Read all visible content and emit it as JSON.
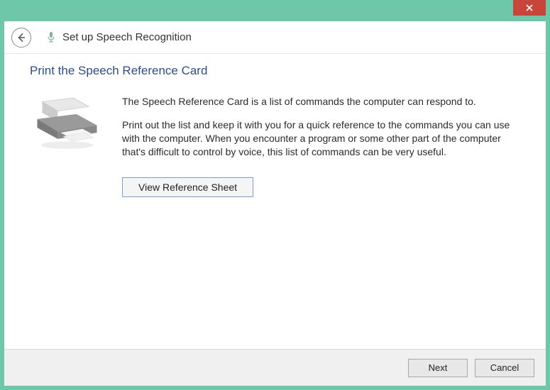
{
  "window": {
    "title": "Set up Speech Recognition"
  },
  "page": {
    "heading": "Print the Speech Reference Card",
    "intro": "The Speech Reference Card is a list of commands the computer can respond to.",
    "details": "Print out the list and keep it with you for a quick reference to the commands you can use with the computer. When you encounter a program or some other part of the computer that's difficult to control by voice, this list of commands can be very useful.",
    "view_button": "View Reference Sheet"
  },
  "footer": {
    "next": "Next",
    "cancel": "Cancel"
  }
}
